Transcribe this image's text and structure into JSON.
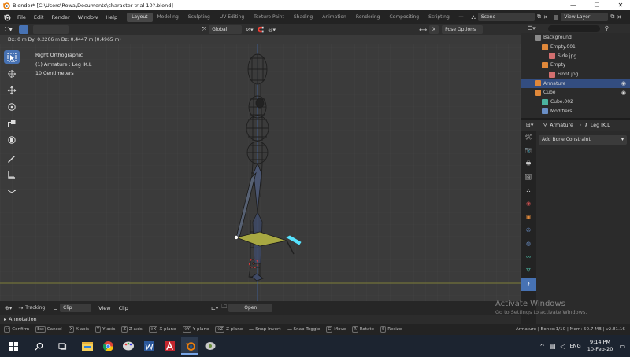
{
  "window": {
    "title": "Blender* [C:\\Users\\Rowa\\Documents\\character trial 10?.blend]",
    "minimize": "—",
    "maximize": "☐",
    "close": "✕"
  },
  "menu": [
    "File",
    "Edit",
    "Render",
    "Window",
    "Help"
  ],
  "workspaces": [
    {
      "label": "Layout",
      "active": true
    },
    {
      "label": "Modeling",
      "active": false
    },
    {
      "label": "Sculpting",
      "active": false
    },
    {
      "label": "UV Editing",
      "active": false
    },
    {
      "label": "Texture Paint",
      "active": false
    },
    {
      "label": "Shading",
      "active": false
    },
    {
      "label": "Animation",
      "active": false
    },
    {
      "label": "Rendering",
      "active": false
    },
    {
      "label": "Compositing",
      "active": false
    },
    {
      "label": "Scripting",
      "active": false
    }
  ],
  "add_workspace": "+",
  "scene": {
    "label": "Scene"
  },
  "view_layer": {
    "label": "View Layer"
  },
  "viewport": {
    "transform_orientation": "Global",
    "x_label": "X",
    "pose_options": "Pose Options",
    "info_bar": "Dx: 0 m   Dy: 0.2206 m  Dz: 0.4447 m (0.4965 m)",
    "view_name": "Right Orthographic",
    "object_info": "(1) Armature : Leg IK.L",
    "scale_info": "10 Centimeters"
  },
  "timeline": {
    "tracking": "Tracking",
    "clip": "Clip",
    "view": "View",
    "clip_menu": "Clip",
    "open": "Open"
  },
  "annotation": {
    "label": "Annotation"
  },
  "status": {
    "hints": [
      {
        "key": "↵",
        "label": "Confirm"
      },
      {
        "key": "Esc",
        "label": "Cancel"
      },
      {
        "key": "X",
        "label": "X axis"
      },
      {
        "key": "Y",
        "label": "Y axis"
      },
      {
        "key": "Z",
        "label": "Z axis"
      },
      {
        "key": "⇧X",
        "label": "X plane"
      },
      {
        "key": "⇧Y",
        "label": "Y plane"
      },
      {
        "key": "⇧Z",
        "label": "Z plane"
      },
      {
        "key": "",
        "label": "Snap Invert"
      },
      {
        "key": "",
        "label": "Snap Toggle"
      },
      {
        "key": "G",
        "label": "Move"
      },
      {
        "key": "R",
        "label": "Rotate"
      },
      {
        "key": "S",
        "label": "Resize"
      }
    ],
    "stats": "Armature | Bones:1/10 | Mem: 50.7 MB | v2.81.16"
  },
  "outliner": {
    "rows": [
      {
        "label": "Background",
        "indent": 1,
        "icon": "collection-icon",
        "color": "#8a8a8a",
        "selected": false
      },
      {
        "label": "Empty.001",
        "indent": 2,
        "icon": "image-empty-icon",
        "color": "#e0883a",
        "selected": false
      },
      {
        "label": "Side.jpg",
        "indent": 3,
        "icon": "image-icon",
        "color": "#d26f6f",
        "selected": false
      },
      {
        "label": "Empty",
        "indent": 2,
        "icon": "image-empty-icon",
        "color": "#e0883a",
        "selected": false
      },
      {
        "label": "Front.jpg",
        "indent": 3,
        "icon": "image-icon",
        "color": "#d26f6f",
        "selected": false
      },
      {
        "label": "Armature",
        "indent": 1,
        "icon": "armature-icon",
        "color": "#e0883a",
        "selected": true
      },
      {
        "label": "Cube",
        "indent": 1,
        "icon": "mesh-icon",
        "color": "#e0883a",
        "selected": false
      },
      {
        "label": "Cube.002",
        "indent": 2,
        "icon": "mesh-data-icon",
        "color": "#4bb3a0",
        "selected": false
      },
      {
        "label": "Modifiers",
        "indent": 2,
        "icon": "wrench-icon",
        "color": "#6a8fc7",
        "selected": false
      }
    ]
  },
  "properties": {
    "breadcrumb_object": "Armature",
    "breadcrumb_bone": "Leg IK.L",
    "add_constraint": "Add Bone Constraint"
  },
  "watermark": {
    "title": "Activate Windows",
    "subtitle": "Go to Settings to activate Windows."
  },
  "taskbar": {
    "language": "ENG",
    "time": "9:14 PM",
    "date": "10-Feb-20"
  },
  "colors": {
    "accent": "#4772b3",
    "viewport_bg": "#3b3b3b",
    "bone_active": "#a8a842",
    "bone_highlight": "#56e3ff",
    "grid_horizon": "#7f7f3a"
  }
}
